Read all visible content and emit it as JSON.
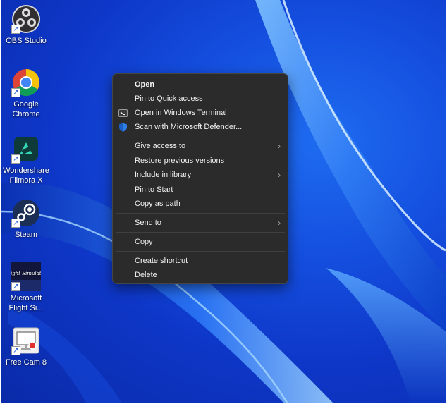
{
  "desktop": {
    "icons": [
      {
        "label": "OBS Studio",
        "icon": "obs-icon"
      },
      {
        "label": "Google Chrome",
        "icon": "chrome-icon"
      },
      {
        "label": "Wondershare Filmora X",
        "icon": "filmora-icon"
      },
      {
        "label": "Steam",
        "icon": "steam-icon"
      },
      {
        "label": "Microsoft Flight Si...",
        "icon": "flight-simulator-icon"
      },
      {
        "label": "Free Cam 8",
        "icon": "free-cam-icon"
      }
    ],
    "flight_logo_text": "Flight Simulator"
  },
  "context_menu": {
    "items": [
      {
        "label": "Open"
      },
      {
        "label": "Pin to Quick access"
      },
      {
        "label": "Open in Windows Terminal",
        "icon": "terminal-icon"
      },
      {
        "label": "Scan with Microsoft Defender...",
        "icon": "defender-shield-icon"
      },
      {
        "label": "Give access to",
        "icon": "chevron-right-icon"
      },
      {
        "label": "Restore previous versions"
      },
      {
        "label": "Include in library",
        "icon": "chevron-right-icon"
      },
      {
        "label": "Pin to Start"
      },
      {
        "label": "Copy as path"
      },
      {
        "label": "Send to",
        "icon": "chevron-right-icon"
      },
      {
        "label": "Copy"
      },
      {
        "label": "Create shortcut"
      },
      {
        "label": "Delete"
      }
    ]
  },
  "colors": {
    "wallpaper_blue": "#1550e0",
    "menu_background": "#2b2b2b",
    "menu_text": "#f2f2f2"
  }
}
